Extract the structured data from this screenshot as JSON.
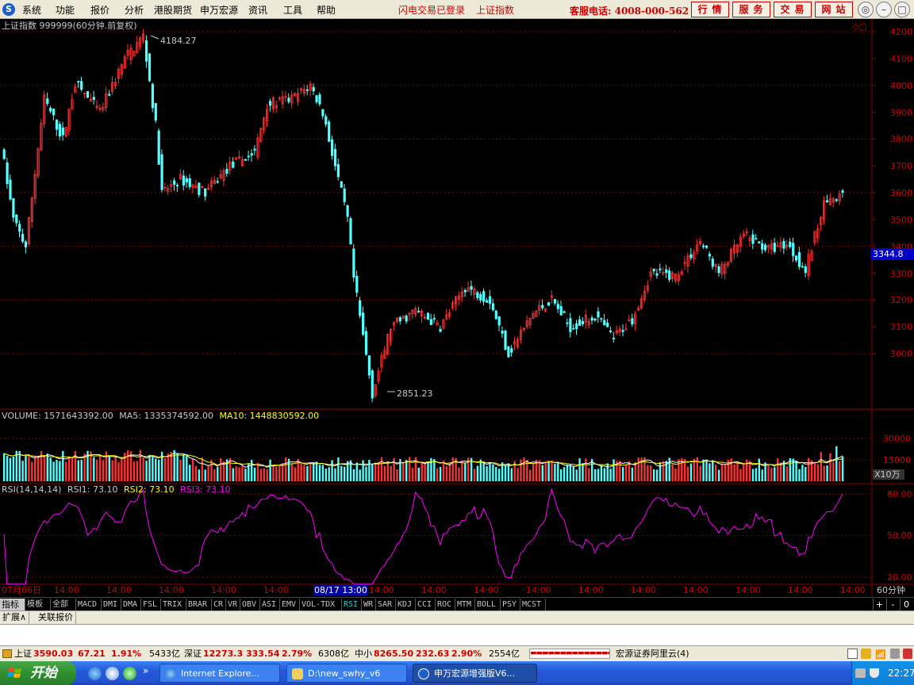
{
  "menu": {
    "logo": "S",
    "items": [
      "系统",
      "功能",
      "报价",
      "分析",
      "港股期货",
      "申万宏源",
      "资讯",
      "工具",
      "帮助"
    ],
    "status_login": "闪电交易已登录",
    "status_index": "上证指数",
    "hotline": "客服电话: 4008-000-562",
    "buttons": [
      "行情",
      "服务",
      "交易",
      "网站"
    ],
    "window_icons": [
      "◎",
      "–",
      "□",
      "×"
    ]
  },
  "main_chart": {
    "title": "上证指数  999999(60分钟.前复权)",
    "high_label": "4184.27",
    "low_label": "2851.23",
    "y_ticks": [
      "4200",
      "4100",
      "4000",
      "3900",
      "3800",
      "3700",
      "3600",
      "3500",
      "3400",
      "3300",
      "3200",
      "3100",
      "3000"
    ],
    "current_price": "3344.8",
    "ylim": [
      2800,
      4230
    ]
  },
  "volume": {
    "label": "VOLUME: 1571643392.00",
    "ma5": "MA5: 1335374592.00",
    "ma10": "MA10: 1448830592.00",
    "y_ticks": [
      "30000",
      "15000"
    ],
    "unit": "X10万"
  },
  "rsi": {
    "label": "RSI(14,14,14)",
    "rsi1": "RSI1: 73.10",
    "rsi2": "RSI2: 73.10",
    "rsi3": "RSI3: 73.10",
    "y_ticks": [
      "80.00",
      "50.00",
      "20.00"
    ]
  },
  "time_axis": {
    "labels": [
      "07月06日",
      "14:00",
      "14:00",
      "14:00",
      "14:00",
      "14:00",
      "08/17 13:00",
      "14:00",
      "14:00",
      "14:00",
      "14:00",
      "14:00",
      "14:00",
      "14:00",
      "14:00",
      "14:00",
      "14:00",
      "14:00"
    ],
    "period": "60分钟"
  },
  "indicator_tabs": [
    "指标",
    "模板",
    "全部",
    "MACD",
    "DMI",
    "DMA",
    "FSL",
    "TRIX",
    "BRAR",
    "CR",
    "VR",
    "OBV",
    "ASI",
    "EMV",
    "VOL-TDX",
    "RSI",
    "WR",
    "SAR",
    "KDJ",
    "CCI",
    "ROC",
    "MTM",
    "BOLL",
    "PSY",
    "MCST"
  ],
  "active_tab": "RSI",
  "tab_controls": [
    "+",
    "-",
    "0"
  ],
  "ext_tabs": [
    "扩展∧",
    "关联报价"
  ],
  "ticker": {
    "sh_name": "上证",
    "sh_value": "3590.03",
    "sh_change": "67.21",
    "sh_pct": "1.91%",
    "sh_amount": "5433亿",
    "sz_name": "深证",
    "sz_value": "12273.3",
    "sz_change": "333.54",
    "sz_pct": "2.79%",
    "sz_amount": "6308亿",
    "sme_name": "中小",
    "sme_value": "8265.50",
    "sme_change": "232.63",
    "sme_pct": "2.90%",
    "sme_amount": "2554亿",
    "broker": "宏源证券阿里云(4)"
  },
  "taskbar": {
    "start": "开始",
    "tasks": [
      "Internet Explore...",
      "D:\\new_swhy_v6",
      "申万宏源增强版V6..."
    ],
    "clock": "22:27"
  },
  "colors": {
    "up": "#ff3232",
    "down": "#54ffff",
    "ma5": "#ffffff",
    "ma10": "#ffff00",
    "rsi": "#ff00ff",
    "grid": "#8c0000"
  }
}
